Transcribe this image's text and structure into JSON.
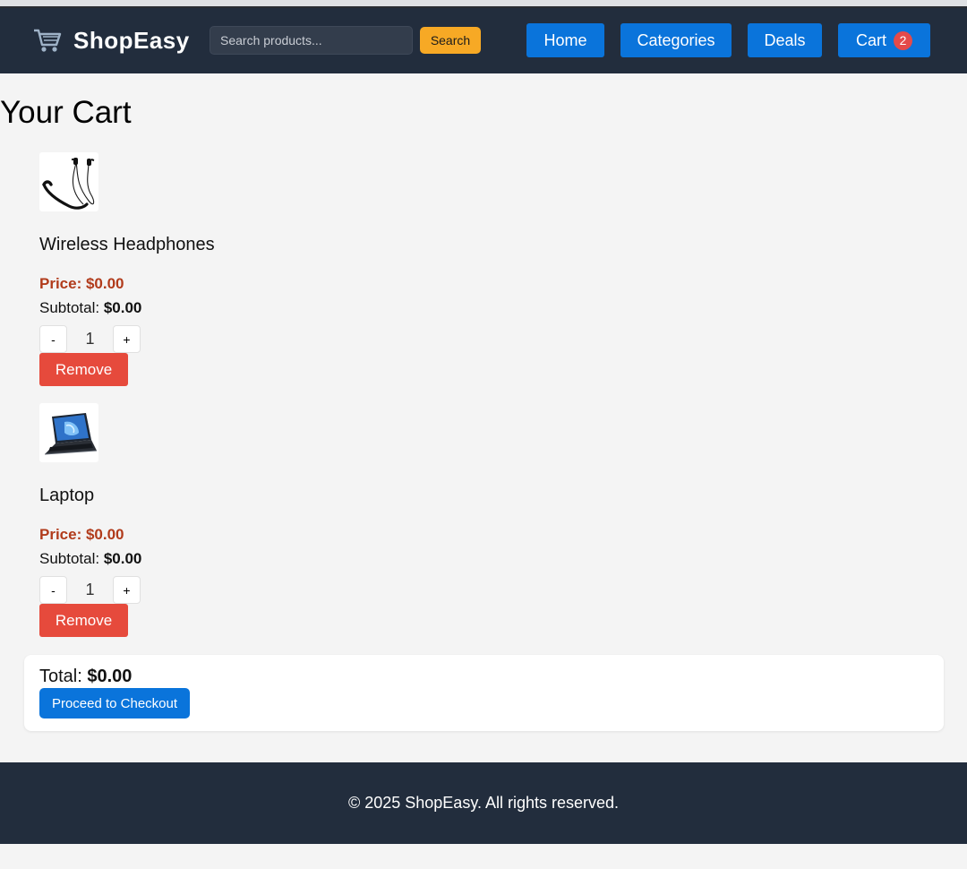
{
  "header": {
    "logo_text": "ShopEasy",
    "search_placeholder": "Search products...",
    "search_label": "Search",
    "nav": {
      "home": "Home",
      "categories": "Categories",
      "deals": "Deals",
      "cart": "Cart",
      "cart_count": "2"
    }
  },
  "page_title": "Your Cart",
  "cart_items": [
    {
      "name": "Wireless Headphones",
      "price_label": "Price: $0.00",
      "subtotal_label": "Subtotal:",
      "subtotal_value": "$0.00",
      "quantity": "1",
      "decrement": "-",
      "increment": "+",
      "remove_label": "Remove",
      "image": "neckband-earphones-image"
    },
    {
      "name": "Laptop",
      "price_label": "Price: $0.00",
      "subtotal_label": "Subtotal:",
      "subtotal_value": "$0.00",
      "quantity": "1",
      "decrement": "-",
      "increment": "+",
      "remove_label": "Remove",
      "image": "laptop-image"
    }
  ],
  "summary": {
    "total_label": "Total:",
    "total_value": "$0.00",
    "checkout_label": "Proceed to Checkout"
  },
  "footer": {
    "text": "© 2025 ShopEasy. All rights reserved."
  },
  "colors": {
    "header_bg": "#222d3d",
    "primary_blue": "#0a74db",
    "search_button": "#f7a925",
    "remove_red": "#e64a3c",
    "price_red": "#b13b1b",
    "badge_red": "#e44a4a"
  }
}
